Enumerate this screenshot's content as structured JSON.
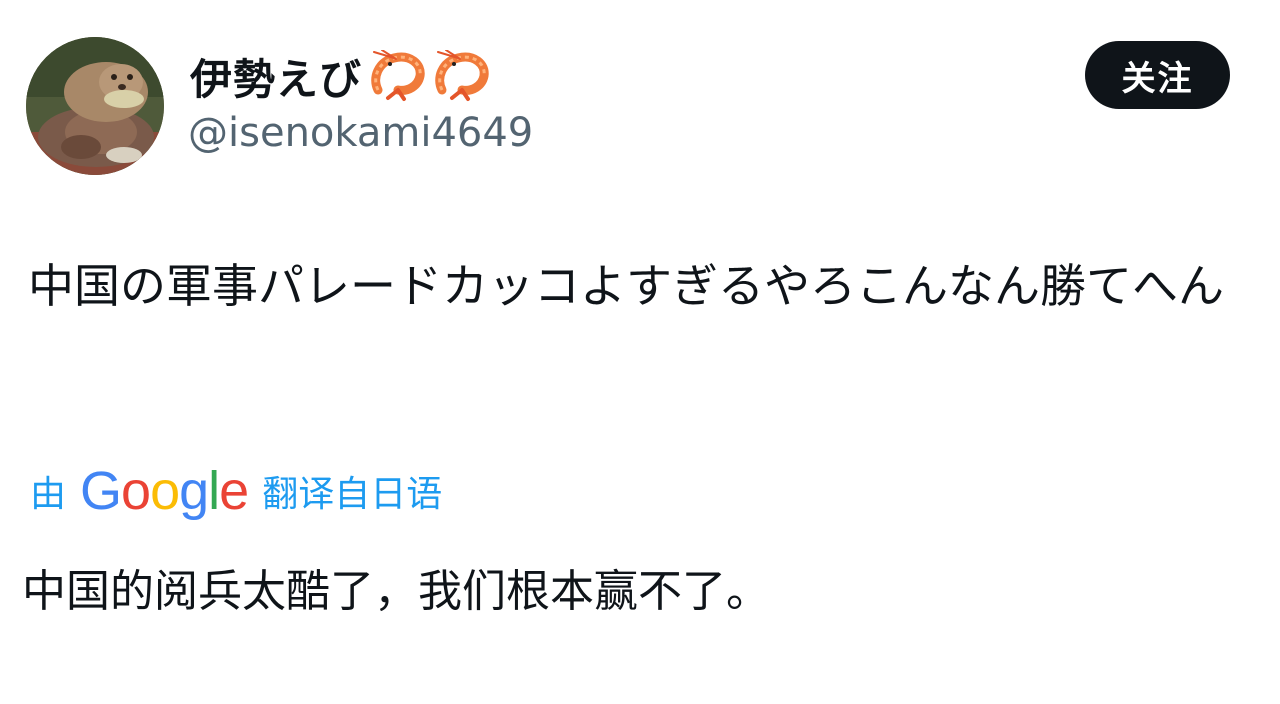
{
  "user": {
    "display_name": "伊勢えび",
    "emoji_icons": [
      "shrimp-icon",
      "shrimp-icon"
    ],
    "handle": "@isenokami4649",
    "avatar_icon": "otter-plush-avatar"
  },
  "follow_button": {
    "label": "关注"
  },
  "tweet": {
    "text": "中国の軍事パレードカッコよすぎるやろこんなん勝てへん"
  },
  "translation": {
    "prefix": "由",
    "provider": "Google",
    "suffix": "翻译自日语",
    "text": "中国的阅兵太酷了，我们根本赢不了。"
  },
  "colors": {
    "accent": "#1d9bf0",
    "follow_bg": "#0f1419",
    "handle": "#536471"
  }
}
